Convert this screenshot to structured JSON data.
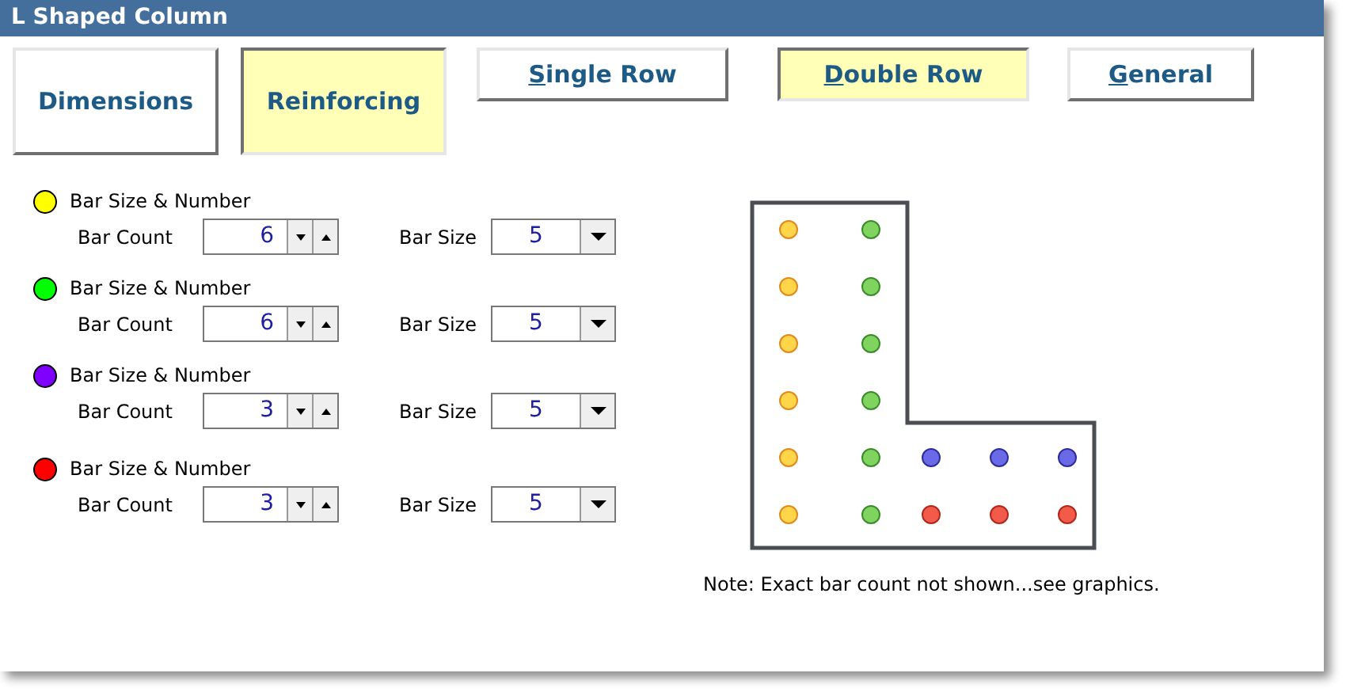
{
  "window": {
    "title": "L Shaped Column"
  },
  "tabs": [
    {
      "label": "Dimensions",
      "kind": "large",
      "selected": false,
      "mnemonic_underlined": false
    },
    {
      "label": "Reinforcing",
      "kind": "large",
      "selected": true,
      "mnemonic_underlined": false
    },
    {
      "label": "Single Row",
      "kind": "small",
      "selected": false,
      "mnemonic_underlined": true
    },
    {
      "label": "Double Row",
      "kind": "small",
      "selected": true,
      "mnemonic_underlined": true
    },
    {
      "label": "General",
      "kind": "small",
      "selected": false,
      "mnemonic_underlined": true
    }
  ],
  "bar_groups": [
    {
      "title": "Bar Size & Number",
      "color": "#ffff00",
      "count_label": "Bar Count",
      "count": "6",
      "size_label": "Bar Size",
      "size": "5"
    },
    {
      "title": "Bar Size & Number",
      "color": "#00ff00",
      "count_label": "Bar Count",
      "count": "6",
      "size_label": "Bar Size",
      "size": "5"
    },
    {
      "title": "Bar Size & Number",
      "color": "#8000ff",
      "count_label": "Bar Count",
      "count": "3",
      "size_label": "Bar Size",
      "size": "5"
    },
    {
      "title": "Bar Size & Number",
      "color": "#ff0000",
      "count_label": "Bar Count",
      "count": "3",
      "size_label": "Bar Size",
      "size": "5"
    }
  ],
  "note": "Note: Exact bar count not shown...see graphics."
}
